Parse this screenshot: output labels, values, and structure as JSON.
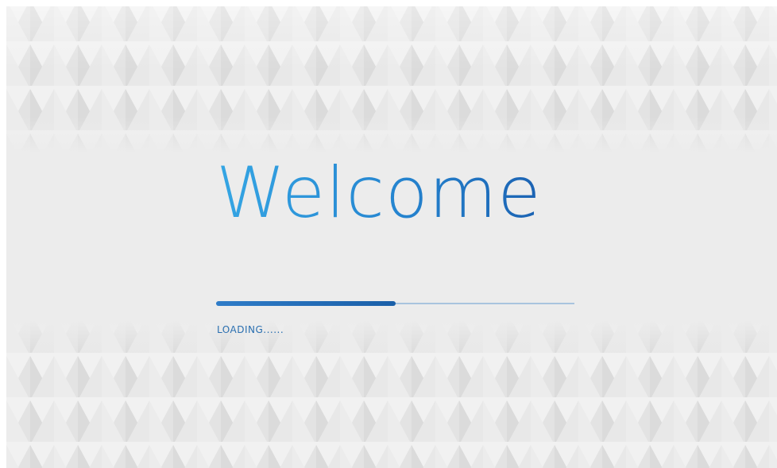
{
  "splash": {
    "title": "Welcome",
    "loading_label": "LOADING......",
    "progress": 0.5
  },
  "colors": {
    "background": "#ececec",
    "title_gradient_start": "#35a6e4",
    "title_gradient_end": "#1b62b2",
    "progress_fill": "#1f66b0",
    "progress_track": "#a9c4de",
    "loading_text": "#2a6fb0"
  },
  "decor": {
    "pattern": "triangle-pattern"
  }
}
